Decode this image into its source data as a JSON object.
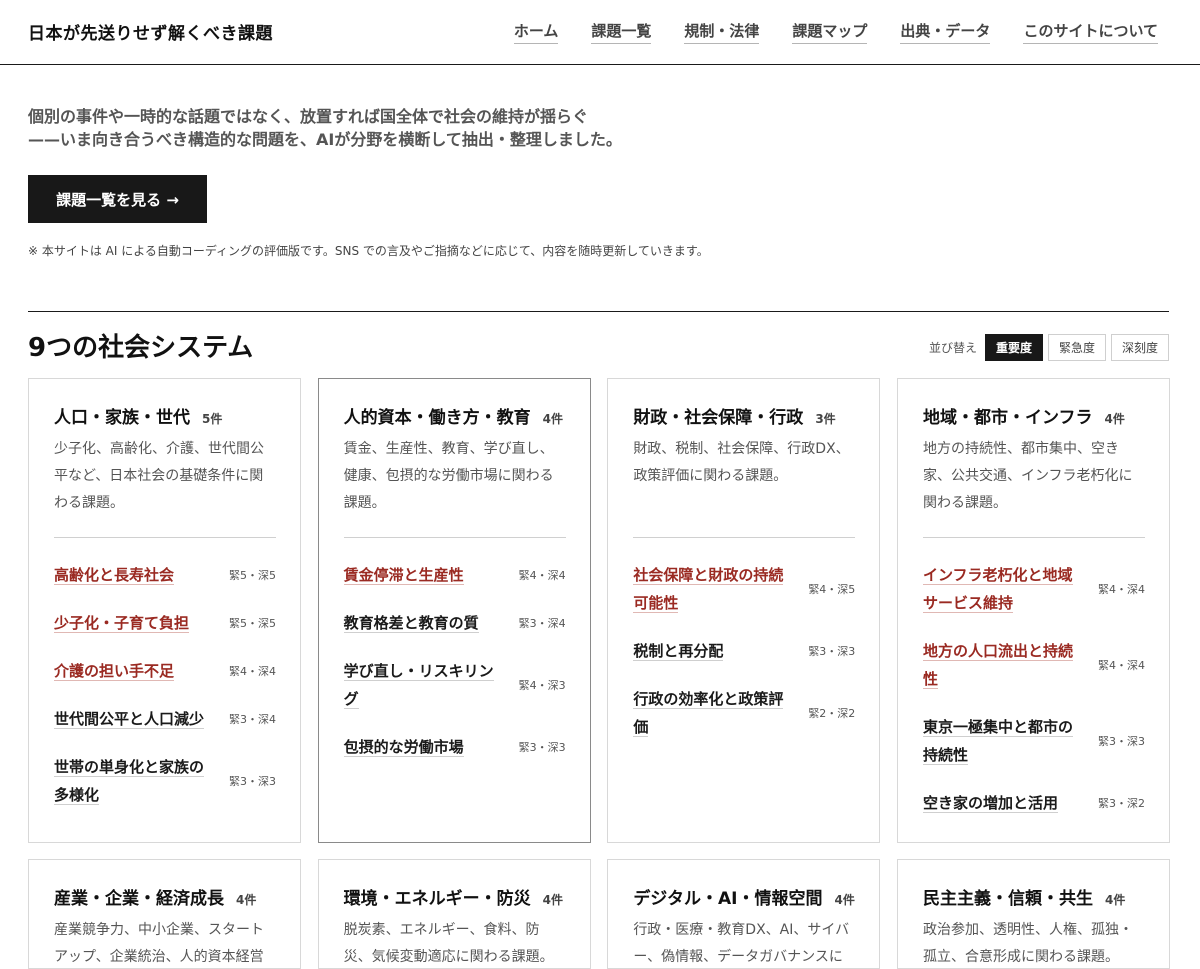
{
  "header": {
    "site_title": "日本が先送りせず解くべき課題",
    "nav": [
      "ホーム",
      "課題一覧",
      "規制・法律",
      "課題マップ",
      "出典・データ",
      "このサイトについて"
    ]
  },
  "intro": {
    "line1": "個別の事件や一時的な話題ではなく、放置すれば国全体で社会の維持が揺らぐ",
    "line2": "——いま向き合うべき構造的な問題を、AIが分野を横断して抽出・整理しました。",
    "cta_label": "課題一覧を見る →",
    "note": "※ 本サイトは AI による自動コーディングの評価版です。SNS での言及やご指摘などに応じて、内容を随時更新していきます。"
  },
  "section": {
    "title": "9つの社会システム",
    "sort_label": "並び替え",
    "sort_options": [
      "重要度",
      "緊急度",
      "深刻度"
    ],
    "sort_selected": "重要度"
  },
  "accent_color": "#9a2a22",
  "cards": [
    {
      "title": "人口・家族・世代",
      "count": "5件",
      "desc": "少子化、高齢化、介護、世代間公平など、日本社会の基礎条件に関わる課題。",
      "issues": [
        {
          "name": "高齢化と長寿社会",
          "meta": "緊5・深5",
          "highlight": true
        },
        {
          "name": "少子化・子育て負担",
          "meta": "緊5・深5",
          "highlight": true
        },
        {
          "name": "介護の担い手不足",
          "meta": "緊4・深4",
          "highlight": true
        },
        {
          "name": "世代間公平と人口減少",
          "meta": "緊3・深4",
          "highlight": false
        },
        {
          "name": "世帯の単身化と家族の多様化",
          "meta": "緊3・深3",
          "highlight": false
        }
      ]
    },
    {
      "title": "人的資本・働き方・教育",
      "count": "4件",
      "desc": "賃金、生産性、教育、学び直し、健康、包摂的な労働市場に関わる課題。",
      "issues": [
        {
          "name": "賃金停滞と生産性",
          "meta": "緊4・深4",
          "highlight": true
        },
        {
          "name": "教育格差と教育の質",
          "meta": "緊3・深4",
          "highlight": false
        },
        {
          "name": "学び直し・リスキリング",
          "meta": "緊4・深3",
          "highlight": false
        },
        {
          "name": "包摂的な労働市場",
          "meta": "緊3・深3",
          "highlight": false
        }
      ]
    },
    {
      "title": "財政・社会保障・行政",
      "count": "3件",
      "desc": "財政、税制、社会保障、行政DX、政策評価に関わる課題。",
      "issues": [
        {
          "name": "社会保障と財政の持続可能性",
          "meta": "緊4・深5",
          "highlight": true
        },
        {
          "name": "税制と再分配",
          "meta": "緊3・深3",
          "highlight": false
        },
        {
          "name": "行政の効率化と政策評価",
          "meta": "緊2・深2",
          "highlight": false
        }
      ]
    },
    {
      "title": "地域・都市・インフラ",
      "count": "4件",
      "desc": "地方の持続性、都市集中、空き家、公共交通、インフラ老朽化に関わる課題。",
      "issues": [
        {
          "name": "インフラ老朽化と地域サービス維持",
          "meta": "緊4・深4",
          "highlight": true
        },
        {
          "name": "地方の人口流出と持続性",
          "meta": "緊4・深4",
          "highlight": true
        },
        {
          "name": "東京一極集中と都市の持続性",
          "meta": "緊3・深3",
          "highlight": false
        },
        {
          "name": "空き家の増加と活用",
          "meta": "緊3・深2",
          "highlight": false
        }
      ]
    },
    {
      "title": "産業・企業・経済成長",
      "count": "4件",
      "desc": "産業競争力、中小企業、スタートアップ、企業統治、人的資本経営",
      "issues": []
    },
    {
      "title": "環境・エネルギー・防災",
      "count": "4件",
      "desc": "脱炭素、エネルギー、食料、防災、気候変動適応に関わる課題。",
      "issues": []
    },
    {
      "title": "デジタル・AI・情報空間",
      "count": "4件",
      "desc": "行政・医療・教育DX、AI、サイバー、偽情報、データガバナンスに",
      "issues": []
    },
    {
      "title": "民主主義・信頼・共生",
      "count": "4件",
      "desc": "政治参加、透明性、人権、孤独・孤立、合意形成に関わる課題。",
      "issues": []
    }
  ]
}
